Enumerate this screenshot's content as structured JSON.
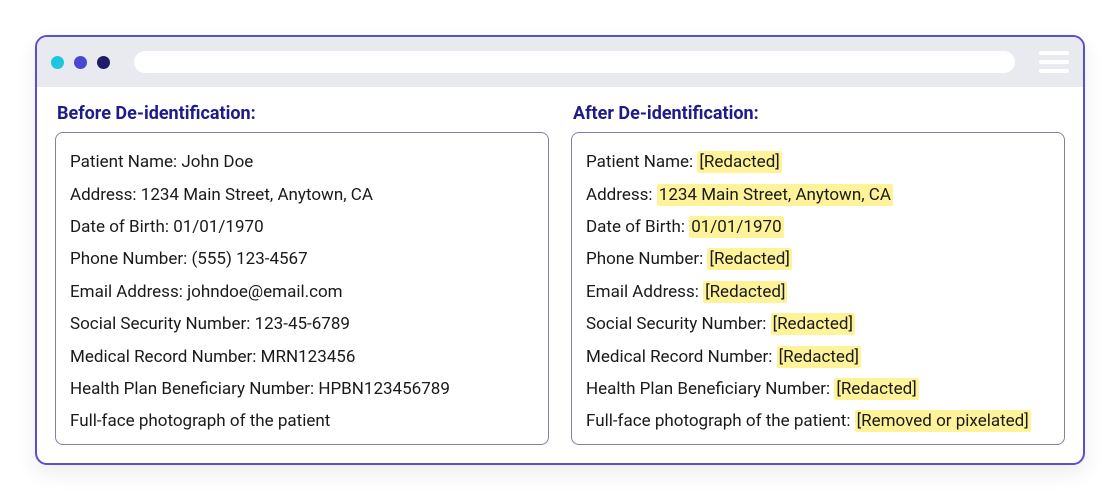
{
  "window": {
    "dot_colors": [
      "#1cc8dd",
      "#4a47d1",
      "#1e1b6b"
    ],
    "url_placeholder": ""
  },
  "left": {
    "heading": "Before De-identification:",
    "rows": [
      {
        "label": "Patient Name: ",
        "value": "John Doe"
      },
      {
        "label": "Address: ",
        "value": "1234 Main Street, Anytown, CA"
      },
      {
        "label": "Date of Birth: ",
        "value": "01/01/1970"
      },
      {
        "label": "Phone Number: ",
        "value": "(555) 123-4567"
      },
      {
        "label": "Email Address: ",
        "value": "johndoe@email.com"
      },
      {
        "label": "Social Security Number: ",
        "value": "123-45-6789"
      },
      {
        "label": "Medical Record Number: ",
        "value": "MRN123456"
      },
      {
        "label": "Health Plan Beneficiary Number: ",
        "value": "HPBN123456789"
      },
      {
        "label": "Full-face photograph of the patient",
        "value": ""
      }
    ]
  },
  "right": {
    "heading": "After De-identification:",
    "rows": [
      {
        "label": "Patient Name: ",
        "value": "[Redacted]",
        "highlighted": true
      },
      {
        "label": "Address: ",
        "value": "1234 Main Street, Anytown, CA",
        "highlighted": true
      },
      {
        "label": "Date of Birth: ",
        "value": "01/01/1970",
        "highlighted": true
      },
      {
        "label": "Phone Number: ",
        "value": "[Redacted]",
        "highlighted": true
      },
      {
        "label": "Email Address: ",
        "value": "[Redacted]",
        "highlighted": true
      },
      {
        "label": "Social Security Number: ",
        "value": "[Redacted]",
        "highlighted": true
      },
      {
        "label": "Medical Record Number: ",
        "value": "[Redacted]",
        "highlighted": true
      },
      {
        "label": "Health Plan Beneficiary Number: ",
        "value": "[Redacted]",
        "highlighted": true
      },
      {
        "label": "Full-face photograph of the patient: ",
        "value": "[Removed or pixelated]",
        "highlighted": true
      }
    ]
  }
}
